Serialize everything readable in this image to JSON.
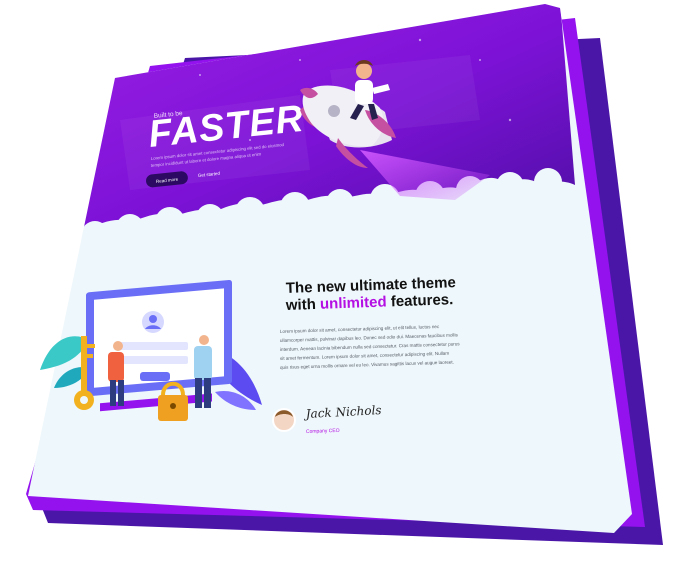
{
  "hero": {
    "eyebrow": "Built to be",
    "headline": "FASTER",
    "intro_lines": [
      "Lorem ipsum dolor sit amet consectetur adipiscing elit sed do eiusmod",
      "tempor incididunt ut labore et dolore magna aliqua ut enim"
    ],
    "primary_button": "Read more",
    "secondary_link": "Get started"
  },
  "feature": {
    "title_line1": "The new ultimate theme",
    "title_line2_prefix": "with ",
    "title_line2_highlight": "unlimited",
    "title_line2_suffix": " features.",
    "body_lines": [
      "Lorem ipsum dolor sit amet, consectetur adipiscing elit, ut elit tellus, luctus nec",
      "ullamcorper mattis, pulvinar dapibus leo. Donec sed odio dui. Maecenas faucibus mollis",
      "interdum. Aenean lacinia bibendum nulla sed consectetur. Cras mattis consectetur purus",
      "sit amet fermentum. Lorem ipsum dolor sit amet, consectetur adipiscing elit. Nullam",
      "quis risus eget urna mollis ornare vel eu leo. Vivamus sagittis lacus vel augue laoreet."
    ]
  },
  "signature": {
    "name": "Jack Nichols",
    "role": "Company CEO"
  },
  "colors": {
    "brand_purple": "#8a10d8",
    "deep_purple": "#4e0fa6",
    "back_layer": "#4a16a8",
    "mid_layer": "#9412ee",
    "page_bg": "#eef7fb",
    "heading_dark": "#111111",
    "accent_magenta": "#b40fe3"
  },
  "icons": {
    "avatar": "user-avatar-icon",
    "lock": "padlock-icon",
    "key": "key-icon",
    "rocket": "rocket-icon"
  }
}
